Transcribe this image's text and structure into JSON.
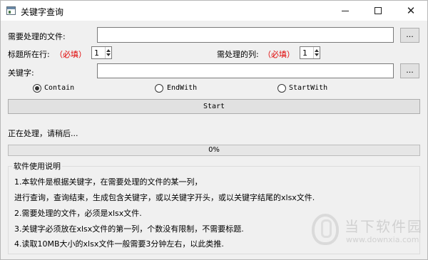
{
  "window": {
    "title": "关键字查询",
    "controls": {
      "minimize": "minimize",
      "maximize": "maximize",
      "close": "✕"
    }
  },
  "form": {
    "file_label": "需要处理的文件:",
    "file_value": "",
    "browse_label": "...",
    "title_row_label": "标题所在行:",
    "title_row_required": "（必填）",
    "title_row_value": "1",
    "column_label": "需处理的列:",
    "column_required": "（必填）",
    "column_value": "1",
    "keyword_label": "关键字:",
    "keyword_value": ""
  },
  "match_mode": {
    "options": [
      "Contain",
      "EndWith",
      "StartWith"
    ],
    "selected": "Contain"
  },
  "start_button": "Start",
  "status_text": "正在处理，请稍后...",
  "progress": {
    "value": 0,
    "label": "0%"
  },
  "help": {
    "title": "软件使用说明",
    "lines": [
      "1.本软件是根据关键字，在需要处理的文件的某一列，",
      "进行查询，查询结束，生成包含关键字，或以关键字开头，或以关键字结尾的xlsx文件.",
      "2.需要处理的文件，必须是xlsx文件.",
      "3.关键字必须放在xlsx文件的第一列，个数没有限制，不需要标题.",
      "4.读取10MB大小的xlsx文件一般需要3分钟左右，以此类推."
    ]
  },
  "watermark": {
    "brand": "当下软件园",
    "url": "www.downxia.com"
  },
  "icons": {
    "app": "app-window-icon",
    "minimize": "minimize-icon",
    "maximize": "maximize-icon",
    "close": "close-icon"
  }
}
